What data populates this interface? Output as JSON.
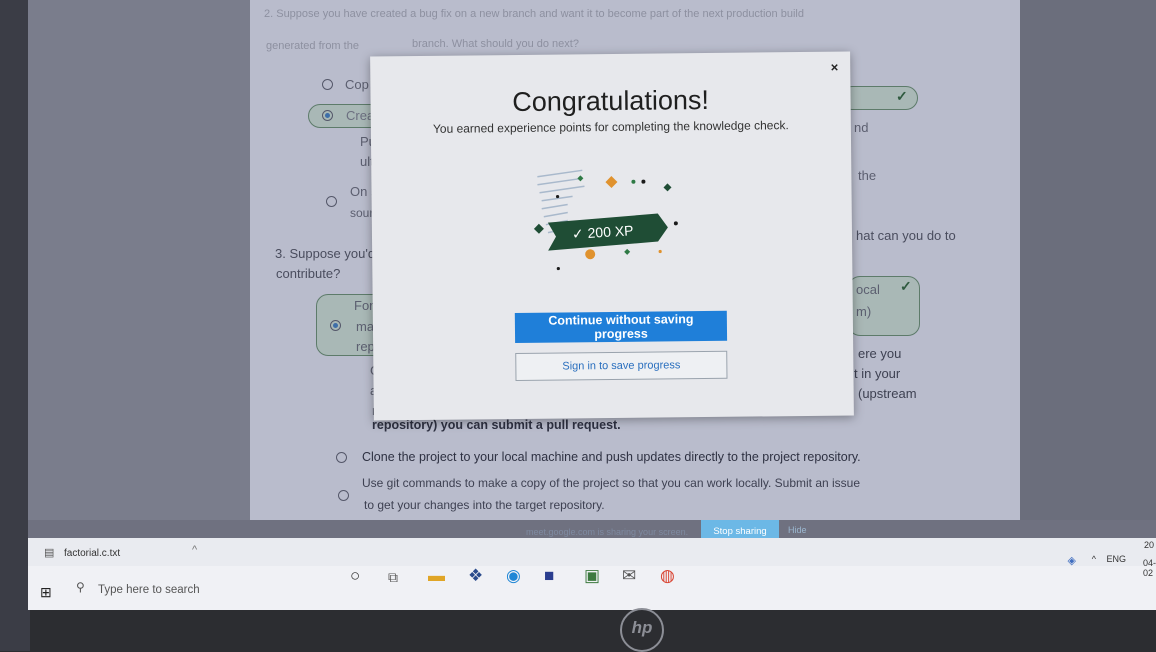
{
  "quiz": {
    "q2_prompt": "2. Suppose you have created a bug fix on a new branch and want it to become part of the next production build",
    "q2_prompt_line2": "generated from the",
    "q2_prompt_line2b": "branch. What should you do next?",
    "q2_opt1_frag": "Cop",
    "q2_opt2_frag": "Crea",
    "q2_opt2b_frag": "Pu",
    "q2_opt2c_frag": "ult",
    "q2_opt3_frag": "On s",
    "q2_opt3b_frag": "sour",
    "q2_right_frag1": "nd",
    "q2_right_frag2": "the",
    "q3_prompt": "3. Suppose you'd l",
    "q3_prompt_right": "hat can you do to",
    "q3_prompt_line2": "contribute?",
    "q3_opt1_frag1": "Fork",
    "q3_opt1_frag2": "mach",
    "q3_opt1_frag3": "repo",
    "q3_opt1_right1": "ocal",
    "q3_opt1_right2": "m)",
    "q3_expl_frag1": "Gi",
    "q3_expl_frag2": "are",
    "q3_expl_frag3": "rep",
    "q3_expl_right1": "ere you",
    "q3_expl_right2": "t in your",
    "q3_expl_right3": "(upstream",
    "q3_expl_last": "repository) you can submit a pull request.",
    "q3_opt2": "Clone the project to your local machine and push updates directly to the project repository.",
    "q3_opt3_line1": "Use git commands to make a copy of the project so that you can work locally. Submit an issue",
    "q3_opt3_line2": "to get your changes into the target repository."
  },
  "modal": {
    "close": "×",
    "title": "Congratulations!",
    "subtitle": "You earned experience points for completing the knowledge check.",
    "xp_badge": "200 XP",
    "primary_button": "Continue without saving progress",
    "secondary_button": "Sign in to save progress"
  },
  "share_bar": {
    "text": "meet.google.com is sharing your screen.",
    "stop": "Stop sharing",
    "hide": "Hide"
  },
  "download_bar": {
    "file": "factorial.c.txt"
  },
  "taskbar": {
    "search_placeholder": "Type here to search",
    "lang": "ENG",
    "time": "20",
    "date": "04-02"
  },
  "colors": {
    "primary_button": "#1f7fd9",
    "badge_green": "#1f4d35",
    "stop_button": "#6cb8e6"
  }
}
